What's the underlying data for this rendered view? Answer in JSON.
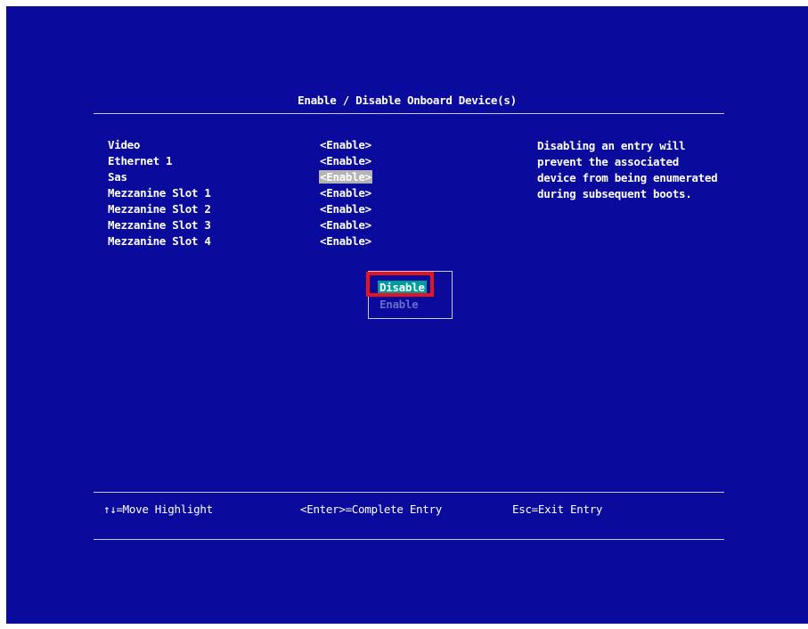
{
  "title": "Enable / Disable Onboard Device(s)",
  "items": [
    {
      "label": "Video",
      "value": "<Enable>"
    },
    {
      "label": "Ethernet 1",
      "value": "<Enable>"
    },
    {
      "label": "Sas",
      "value": "<Enable>"
    },
    {
      "label": "Mezzanine Slot 1",
      "value": "<Enable>"
    },
    {
      "label": "Mezzanine Slot 2",
      "value": "<Enable>"
    },
    {
      "label": "Mezzanine Slot 3",
      "value": "<Enable>"
    },
    {
      "label": "Mezzanine Slot 4",
      "value": "<Enable>"
    }
  ],
  "help_lines": [
    "Disabling an entry will",
    "prevent the associated",
    "device from being enumerated",
    "during subsequent boots."
  ],
  "popup": {
    "selected": "Disable",
    "other": "Enable"
  },
  "footer": {
    "move": "↑↓=Move Highlight",
    "enter": "<Enter>=Complete Entry",
    "esc": "Esc=Exit Entry"
  },
  "colors": {
    "background": "#0a0a9c",
    "selection": "#009c9c",
    "highlight": "#b4b4b4",
    "annotation": "#e8141c"
  }
}
